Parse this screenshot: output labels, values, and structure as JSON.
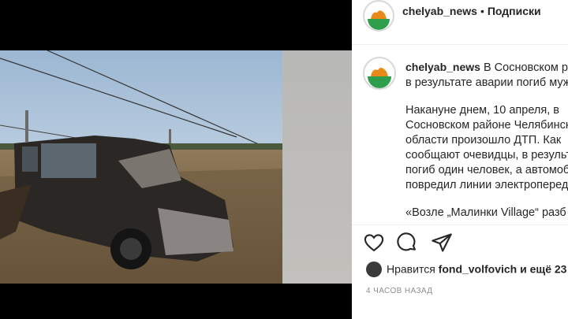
{
  "header": {
    "username": "chelyab_news",
    "separator": "•",
    "follow_label": "Подписки"
  },
  "post": {
    "image_alt": "wrecked SUV photo",
    "caption_user": "chelyab_news",
    "caption_lines": [
      "В Сосновском р",
      "в результате аварии погиб муж"
    ],
    "body_lines": [
      "Накануне днем, 10 апреля, в",
      "Сосновском районе Челябинск",
      "области произошло ДТП. Как",
      "сообщают очевидцы, в результ",
      "погиб один человек, а автомоб",
      "повредил линии электроперед"
    ],
    "quote_line": "«Возле „Малинки Village“ разб"
  },
  "actions": {
    "like_icon": "heart-icon",
    "comment_icon": "comment-icon",
    "share_icon": "paper-plane-icon"
  },
  "likes": {
    "prefix": "Нравится",
    "user": "fond_volfovich",
    "suffix": "и ещё 23"
  },
  "timestamp": "4 ЧАСОВ НАЗАД",
  "colors": {
    "text": "#262626",
    "muted": "#8e8e8e",
    "divider": "#efefef",
    "logo_green": "#2e9e4d",
    "logo_orange": "#e8891a"
  }
}
